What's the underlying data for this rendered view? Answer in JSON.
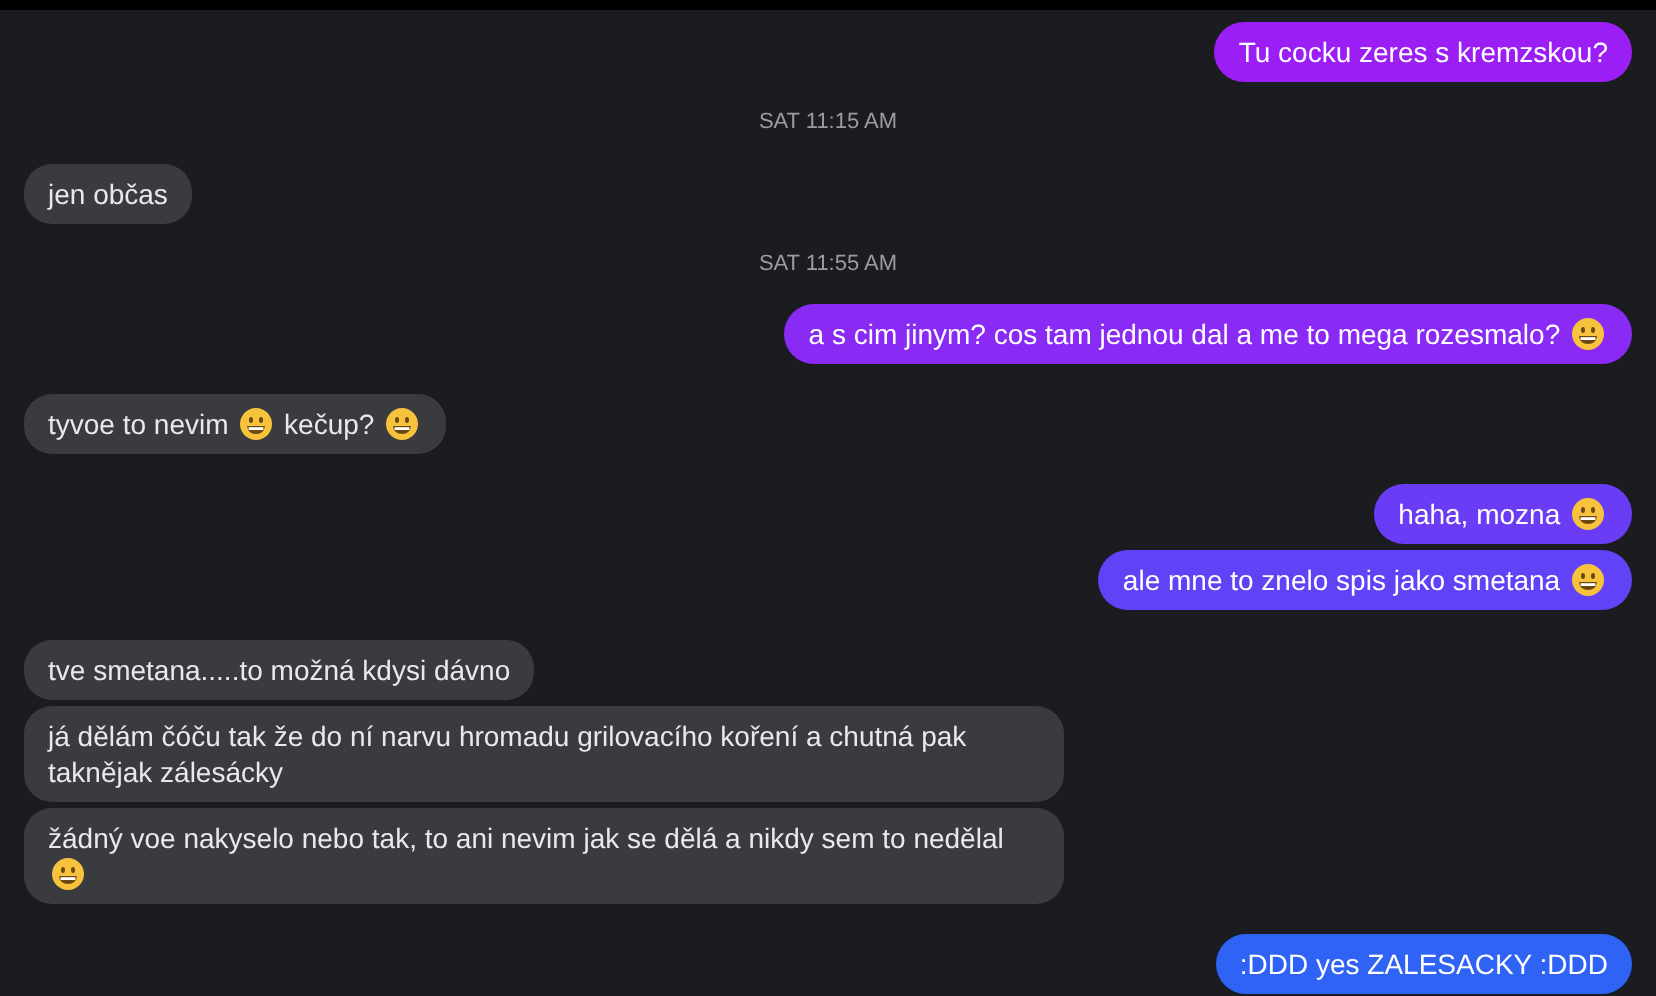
{
  "items": [
    {
      "kind": "sent_message",
      "color": "#9b1ff5",
      "parts": [
        {
          "kind": "text",
          "text": "Tu cocku zeres s kremzskou?"
        }
      ]
    },
    {
      "kind": "timestamp",
      "text": "SAT 11:15 AM"
    },
    {
      "kind": "received_message",
      "parts": [
        {
          "kind": "text",
          "text": "jen občas"
        }
      ]
    },
    {
      "kind": "timestamp",
      "text": "SAT 11:55 AM"
    },
    {
      "kind": "sent_message",
      "color": "#8a2af5",
      "parts": [
        {
          "kind": "text",
          "text": "a s cim jinym? cos tam jednou dal a me to mega rozesmalo?"
        },
        {
          "kind": "emoji"
        }
      ]
    },
    {
      "kind": "received_message",
      "parts": [
        {
          "kind": "text",
          "text": "tyvoe to nevim"
        },
        {
          "kind": "emoji"
        },
        {
          "kind": "text",
          "text": "kečup?"
        },
        {
          "kind": "emoji"
        }
      ]
    },
    {
      "kind": "sent_message",
      "color": "#6a3cf6",
      "parts": [
        {
          "kind": "text",
          "text": "haha, mozna"
        },
        {
          "kind": "emoji"
        }
      ]
    },
    {
      "kind": "sent_message",
      "color": "#6242f6",
      "parts": [
        {
          "kind": "text",
          "text": "ale mne to znelo spis jako smetana"
        },
        {
          "kind": "emoji"
        }
      ]
    },
    {
      "kind": "received_message",
      "parts": [
        {
          "kind": "text",
          "text": "tve smetana.....to možná kdysi dávno"
        }
      ]
    },
    {
      "kind": "received_message",
      "parts": [
        {
          "kind": "text",
          "text": "já dělám čóču tak že do ní narvu hromadu grilovacího koření a chutná pak taknějak zálesácky"
        }
      ]
    },
    {
      "kind": "received_message",
      "parts": [
        {
          "kind": "text",
          "text": "žádný voe nakyselo nebo tak, to ani nevim jak se dělá a nikdy sem to nedělal"
        },
        {
          "kind": "emoji"
        }
      ]
    },
    {
      "kind": "sent_message",
      "color": "#2f63f5",
      "parts": [
        {
          "kind": "text",
          "text": ":DDD yes ZALESACKY :DDD"
        }
      ]
    }
  ]
}
